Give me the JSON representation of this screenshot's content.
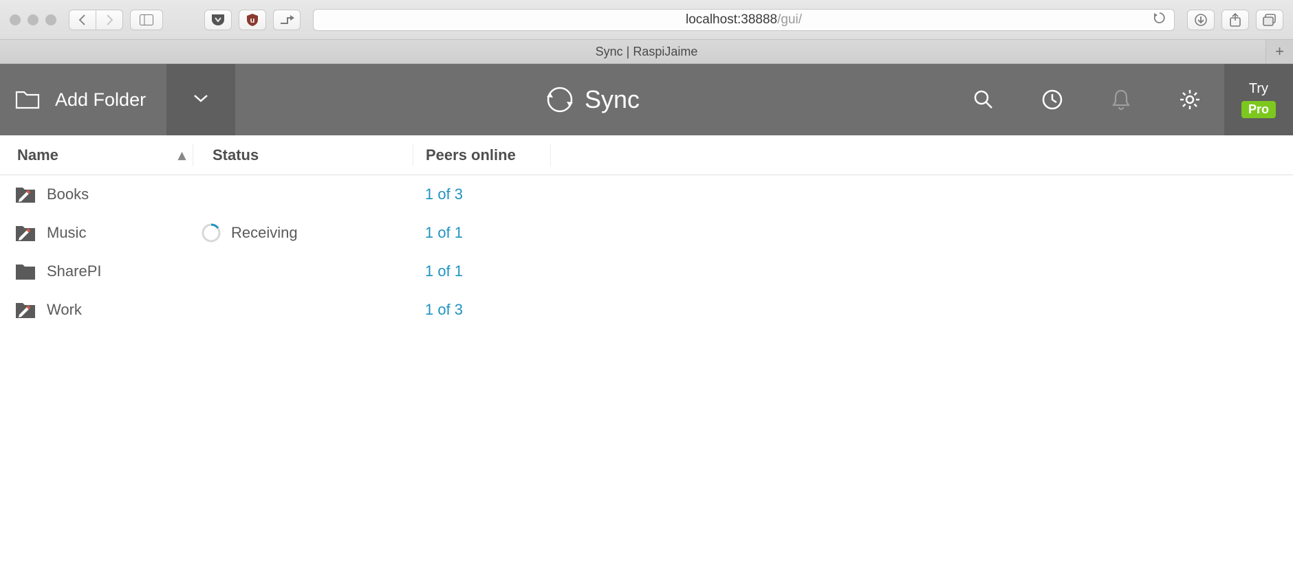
{
  "browser": {
    "url_host": "localhost:38888",
    "url_path": "/gui/",
    "tab_title": "Sync | RaspiJaime"
  },
  "toolbar": {
    "add_folder_label": "Add Folder",
    "brand": "Sync",
    "try_label": "Try",
    "pro_label": "Pro"
  },
  "table": {
    "columns": {
      "name": "Name",
      "status": "Status",
      "peers": "Peers online"
    },
    "rows": [
      {
        "name": "Books",
        "status": "",
        "peers": "1 of 3",
        "icon": "folder-rw"
      },
      {
        "name": "Music",
        "status": "Receiving",
        "peers": "1 of 1",
        "icon": "folder-rw"
      },
      {
        "name": "SharePI",
        "status": "",
        "peers": "1 of 1",
        "icon": "folder"
      },
      {
        "name": "Work",
        "status": "",
        "peers": "1 of 3",
        "icon": "folder-rw"
      }
    ]
  },
  "colors": {
    "link": "#1f93c1",
    "toolbar_bg": "#6f6f6f",
    "toolbar_bg_dark": "#5f5f5f",
    "pro_green": "#7dc81e"
  }
}
